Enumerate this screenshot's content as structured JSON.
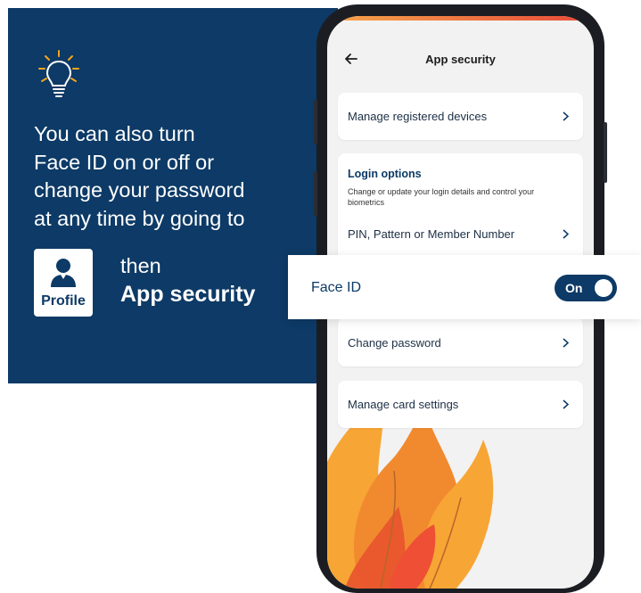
{
  "promo": {
    "tip_lines": [
      "You can also turn",
      "Face ID on or off or",
      "change your password",
      "at any time by going to"
    ],
    "profile_tile_label": "Profile",
    "then_text": "then",
    "destination": "App security"
  },
  "screen": {
    "header_title": "App security",
    "rows": {
      "manage_devices": "Manage registered devices",
      "pin_pattern": "PIN, Pattern or Member Number",
      "change_password": "Change password",
      "manage_card": "Manage card settings"
    },
    "login_options": {
      "title": "Login options",
      "description": "Change or update your login details and control your biometrics"
    }
  },
  "face_id": {
    "label": "Face ID",
    "toggle_state": "On"
  },
  "icons": [
    "lightbulb-icon",
    "person-icon",
    "back-arrow-icon",
    "chevron-right-icon"
  ],
  "colors": {
    "navy": "#0d3a66",
    "bulb_orange": "#f4a51c",
    "screen_bg": "#f2f2f2"
  }
}
